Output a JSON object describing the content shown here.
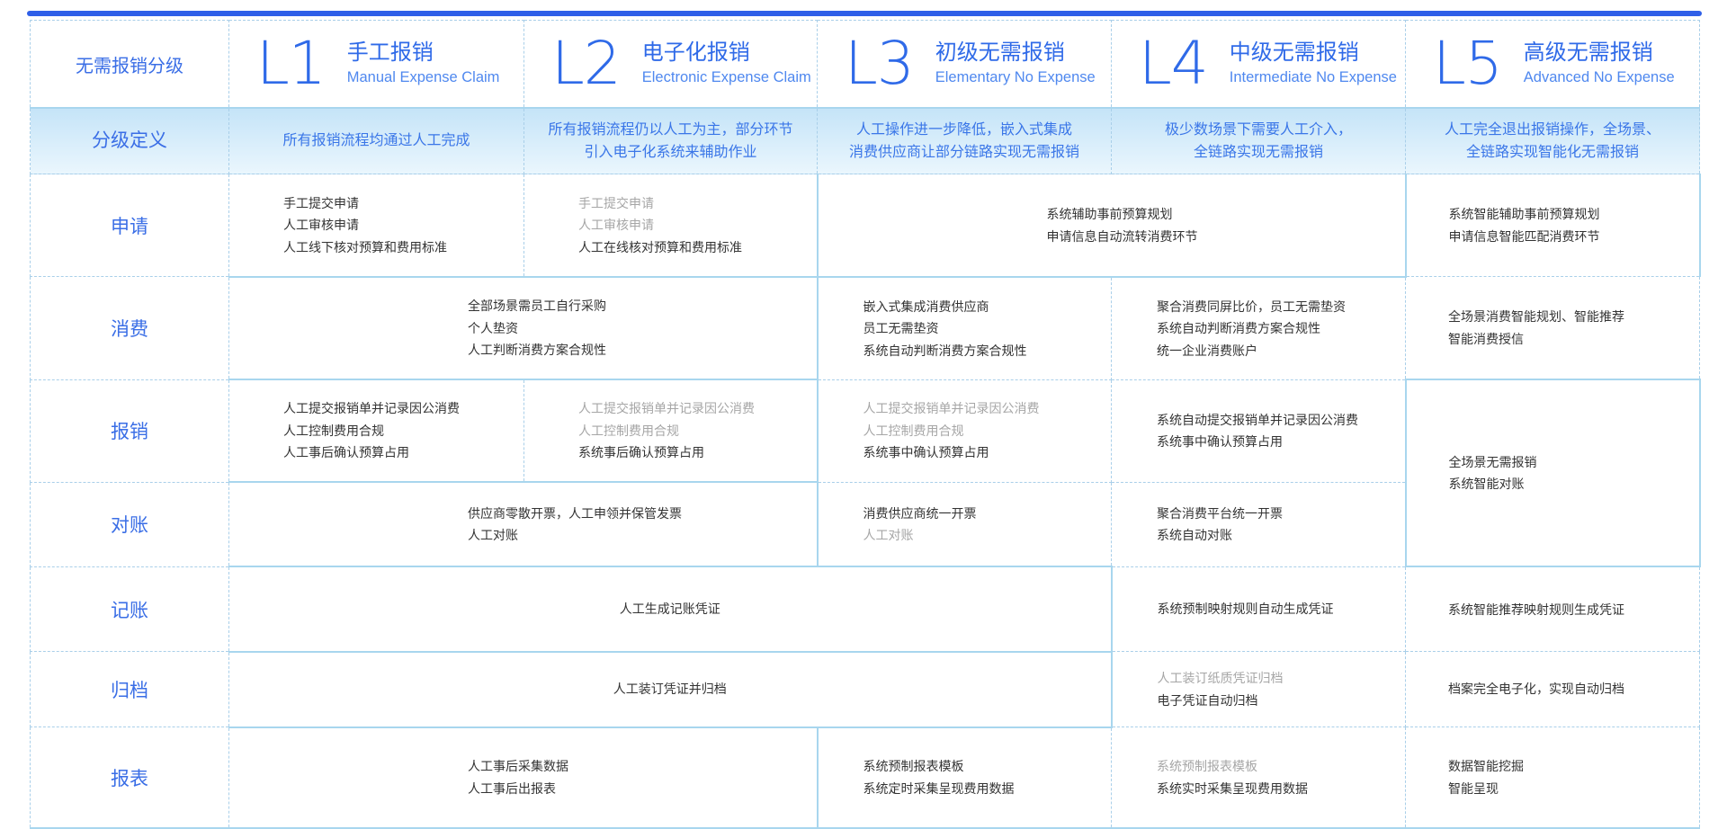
{
  "header": {
    "corner_label": "无需报销分级",
    "levels": [
      {
        "num": "L1",
        "name": "手工报销",
        "en": "Manual Expense Claim"
      },
      {
        "num": "L2",
        "name": "电子化报销",
        "en": "Electronic Expense Claim"
      },
      {
        "num": "L3",
        "name": "初级无需报销",
        "en": "Elementary No Expense"
      },
      {
        "num": "L4",
        "name": "中级无需报销",
        "en": "Intermediate No Expense"
      },
      {
        "num": "L5",
        "name": "高级无需报销",
        "en": "Advanced No Expense"
      }
    ]
  },
  "definition": {
    "label": "分级定义",
    "l1": [
      "所有报销流程均通过人工完成"
    ],
    "l2": [
      "所有报销流程仍以人工为主，部分环节",
      "引入电子化系统来辅助作业"
    ],
    "l3": [
      "人工操作进一步降低，嵌入式集成",
      "消费供应商让部分链路实现无需报销"
    ],
    "l4": [
      "极少数场景下需要人工介入，",
      "全链路实现无需报销"
    ],
    "l5": [
      "人工完全退出报销操作，全场景、",
      "全链路实现智能化无需报销"
    ]
  },
  "rows": {
    "apply": {
      "label": "申请",
      "l1": [
        "手工提交申请",
        "人工审核申请",
        "人工线下核对预算和费用标准"
      ],
      "l2": [
        "手工提交申请",
        "人工审核申请",
        "人工在线核对预算和费用标准"
      ],
      "l3_l4": [
        "系统辅助事前预算规划",
        "申请信息自动流转消费环节"
      ],
      "l5": [
        "系统智能辅助事前预算规划",
        "申请信息智能匹配消费环节"
      ]
    },
    "consume": {
      "label": "消费",
      "l1_l2": [
        "全部场景需员工自行采购",
        "个人垫资",
        "人工判断消费方案合规性"
      ],
      "l3": [
        "嵌入式集成消费供应商",
        "员工无需垫资",
        "系统自动判断消费方案合规性"
      ],
      "l4": [
        "聚合消费同屏比价，员工无需垫资",
        "系统自动判断消费方案合规性",
        "统一企业消费账户"
      ],
      "l5": [
        "全场景消费智能规划、智能推荐",
        "智能消费授信"
      ]
    },
    "reimburse": {
      "label": "报销",
      "l1": [
        "人工提交报销单并记录因公消费",
        "人工控制费用合规",
        "人工事后确认预算占用"
      ],
      "l2": [
        "人工提交报销单并记录因公消费",
        "人工控制费用合规",
        "系统事后确认预算占用"
      ],
      "l3": [
        "人工提交报销单并记录因公消费",
        "人工控制费用合规",
        "系统事中确认预算占用"
      ],
      "l4": [
        "系统自动提交报销单并记录因公消费",
        "系统事中确认预算占用"
      ],
      "l5": [
        "全场景无需报销",
        "系统智能对账"
      ]
    },
    "reconcile": {
      "label": "对账",
      "l1_l2": [
        "供应商零散开票，人工申领并保管发票",
        "人工对账"
      ],
      "l3": [
        "消费供应商统一开票",
        "人工对账"
      ],
      "l4": [
        "聚合消费平台统一开票",
        "系统自动对账"
      ]
    },
    "bookkeeping": {
      "label": "记账",
      "l1_l3": [
        "人工生成记账凭证"
      ],
      "l4": [
        "系统预制映射规则自动生成凭证"
      ],
      "l5": [
        "系统智能推荐映射规则生成凭证"
      ]
    },
    "archive": {
      "label": "归档",
      "l1_l3": [
        "人工装订凭证并归档"
      ],
      "l4": [
        "人工装订纸质凭证归档",
        "电子凭证自动归档"
      ],
      "l5": [
        "档案完全电子化，实现自动归档"
      ]
    },
    "report": {
      "label": "报表",
      "l1_l2": [
        "人工事后采集数据",
        "人工事后出报表"
      ],
      "l3": [
        "系统预制报表模板",
        "系统定时采集呈现费用数据"
      ],
      "l4": [
        "系统预制报表模板",
        "系统实时采集呈现费用数据"
      ],
      "l5": [
        "数据智能挖掘",
        "智能呈现"
      ]
    }
  },
  "colors": {
    "accent": "#2f6ae8",
    "topbar": "#2f5fe8",
    "muted": "#a6a6a6",
    "grid": "#a9cfe9"
  }
}
